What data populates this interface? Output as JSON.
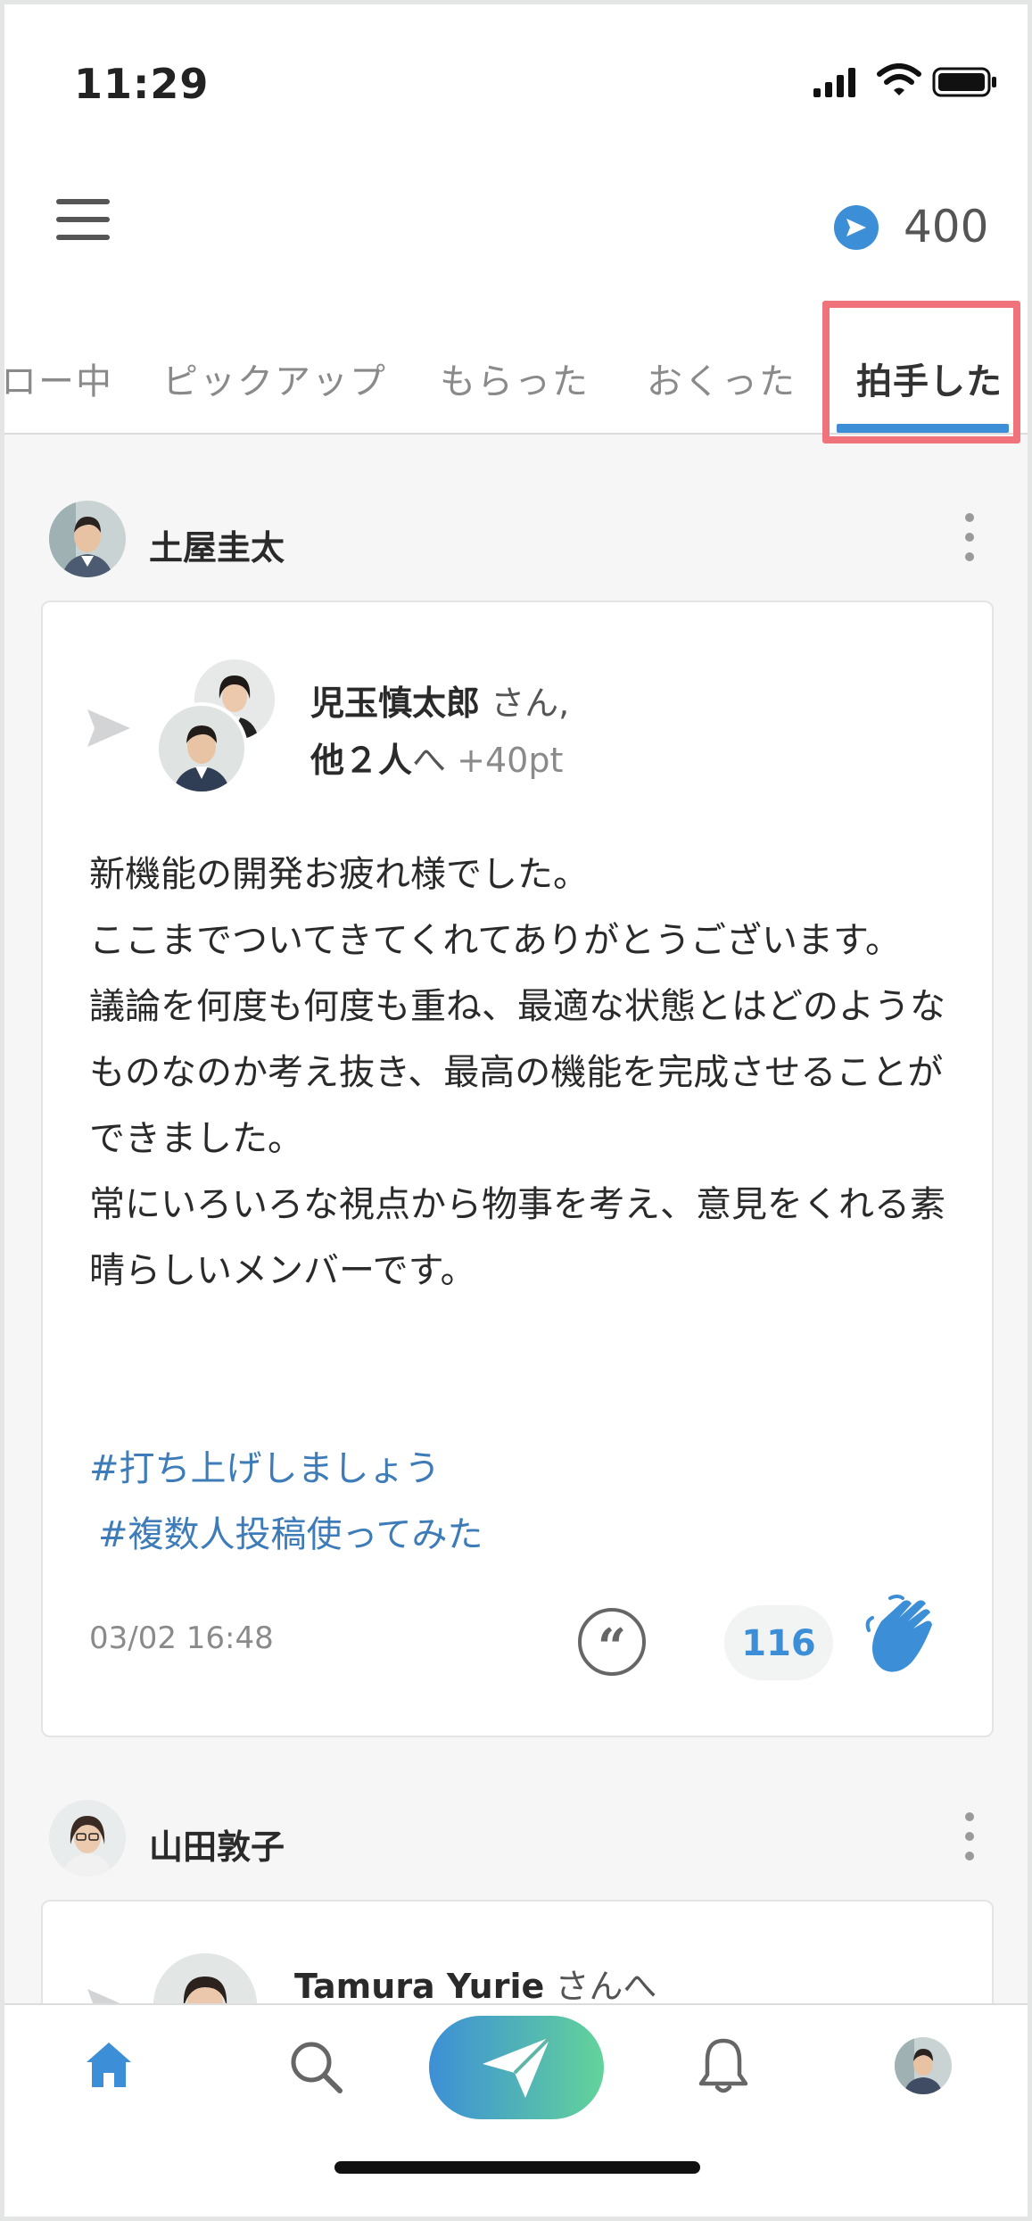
{
  "status_bar": {
    "time": "11:29"
  },
  "header": {
    "points": "400"
  },
  "tabs": [
    {
      "label": "ロー中",
      "active": false
    },
    {
      "label": "ピックアップ",
      "active": false
    },
    {
      "label": "もらった",
      "active": false
    },
    {
      "label": "おくった",
      "active": false
    },
    {
      "label": "拍手した",
      "active": true
    }
  ],
  "posts": [
    {
      "author": "土屋圭太",
      "recipient_name": "児玉慎太郎",
      "recipient_suffix": "さん,",
      "others": "他２人",
      "to_suffix": "へ",
      "points": "+40pt",
      "message": "新機能の開発お疲れ様でした。\nここまでついてきてくれてありがとうございます。\n議論を何度も何度も重ね、最適な状態とはどのようなものなのか考え抜き、最高の機能を完成させることができました。\n常にいろいろな視点から物事を考え、意見をくれる素晴らしいメンバーです。",
      "tags": [
        "#打ち上げしましょう",
        "#複数人投稿使ってみた"
      ],
      "date": "03/02 16:48",
      "clap_count": "116"
    },
    {
      "author": "山田敦子",
      "recipient_name": "Tamura Yurie",
      "recipient_suffix": "さんへ"
    }
  ],
  "colors": {
    "accent": "#3c8fd6",
    "highlight": "#f0727a",
    "tag": "#3d7cb8"
  },
  "icons": [
    "menu-icon",
    "send-icon",
    "quote-icon",
    "clap-icon",
    "home-icon",
    "search-icon",
    "bell-icon"
  ]
}
